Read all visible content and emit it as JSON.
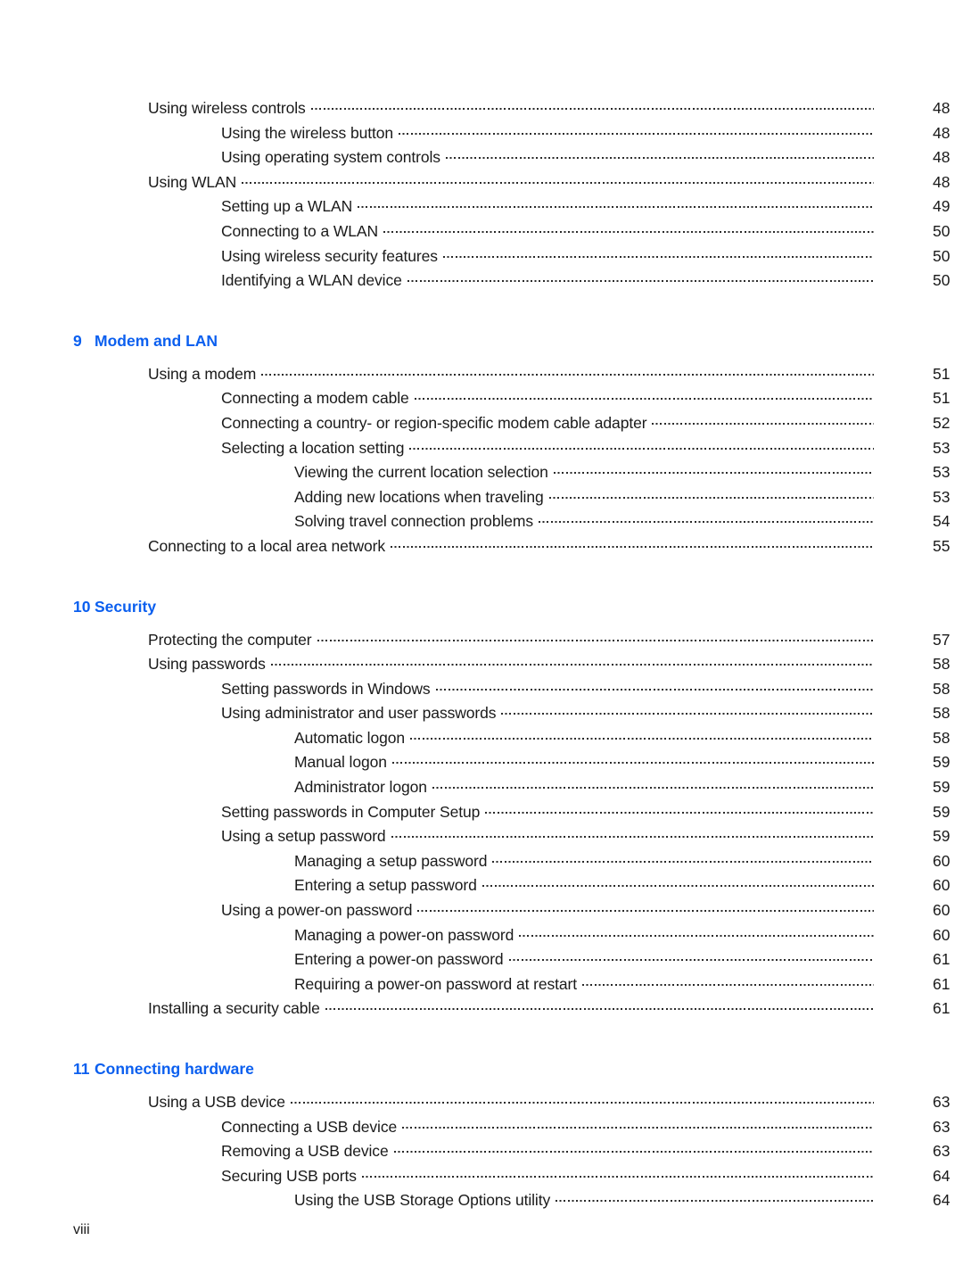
{
  "document": {
    "type": "table-of-contents",
    "page_label": "viii",
    "accent_color": "#0b5fef",
    "text_color": "#1a1a1a"
  },
  "sections": [
    {
      "chapter_number": null,
      "chapter_title": null,
      "entries": [
        {
          "level": 1,
          "title": "Using wireless controls",
          "page": "48"
        },
        {
          "level": 2,
          "title": "Using the wireless button",
          "page": "48"
        },
        {
          "level": 2,
          "title": "Using operating system controls",
          "page": "48"
        },
        {
          "level": 1,
          "title": "Using WLAN",
          "page": "48"
        },
        {
          "level": 2,
          "title": "Setting up a WLAN",
          "page": "49"
        },
        {
          "level": 2,
          "title": "Connecting to a WLAN",
          "page": "50"
        },
        {
          "level": 2,
          "title": "Using wireless security features",
          "page": "50"
        },
        {
          "level": 2,
          "title": "Identifying a WLAN device",
          "page": "50"
        }
      ]
    },
    {
      "chapter_number": "9",
      "chapter_title": "Modem and LAN",
      "entries": [
        {
          "level": 1,
          "title": "Using a modem",
          "page": "51"
        },
        {
          "level": 2,
          "title": "Connecting a modem cable",
          "page": "51"
        },
        {
          "level": 2,
          "title": "Connecting a country- or region-specific modem cable adapter",
          "page": "52"
        },
        {
          "level": 2,
          "title": "Selecting a location setting",
          "page": "53"
        },
        {
          "level": 3,
          "title": "Viewing the current location selection",
          "page": "53"
        },
        {
          "level": 3,
          "title": "Adding new locations when traveling",
          "page": "53"
        },
        {
          "level": 3,
          "title": "Solving travel connection problems",
          "page": "54"
        },
        {
          "level": 1,
          "title": "Connecting to a local area network",
          "page": "55"
        }
      ]
    },
    {
      "chapter_number": "10",
      "chapter_title": "Security",
      "entries": [
        {
          "level": 1,
          "title": "Protecting the computer",
          "page": "57"
        },
        {
          "level": 1,
          "title": "Using passwords",
          "page": "58"
        },
        {
          "level": 2,
          "title": "Setting passwords in Windows",
          "page": "58"
        },
        {
          "level": 2,
          "title": "Using administrator and user passwords",
          "page": "58"
        },
        {
          "level": 3,
          "title": "Automatic logon",
          "page": "58"
        },
        {
          "level": 3,
          "title": "Manual logon",
          "page": "59"
        },
        {
          "level": 3,
          "title": "Administrator logon",
          "page": "59"
        },
        {
          "level": 2,
          "title": "Setting passwords in Computer Setup",
          "page": "59"
        },
        {
          "level": 2,
          "title": "Using a setup password",
          "page": "59"
        },
        {
          "level": 3,
          "title": "Managing a setup password",
          "page": "60"
        },
        {
          "level": 3,
          "title": "Entering a setup password",
          "page": "60"
        },
        {
          "level": 2,
          "title": "Using a power-on password",
          "page": "60"
        },
        {
          "level": 3,
          "title": "Managing a power-on password",
          "page": "60"
        },
        {
          "level": 3,
          "title": "Entering a power-on password",
          "page": "61"
        },
        {
          "level": 3,
          "title": "Requiring a power-on password at restart",
          "page": "61"
        },
        {
          "level": 1,
          "title": "Installing a security cable",
          "page": "61"
        }
      ]
    },
    {
      "chapter_number": "11",
      "chapter_title": "Connecting hardware",
      "entries": [
        {
          "level": 1,
          "title": "Using a USB device",
          "page": "63"
        },
        {
          "level": 2,
          "title": "Connecting a USB device",
          "page": "63"
        },
        {
          "level": 2,
          "title": "Removing a USB device",
          "page": "63"
        },
        {
          "level": 2,
          "title": "Securing USB ports",
          "page": "64"
        },
        {
          "level": 3,
          "title": "Using the USB Storage Options utility",
          "page": "64"
        }
      ]
    }
  ]
}
